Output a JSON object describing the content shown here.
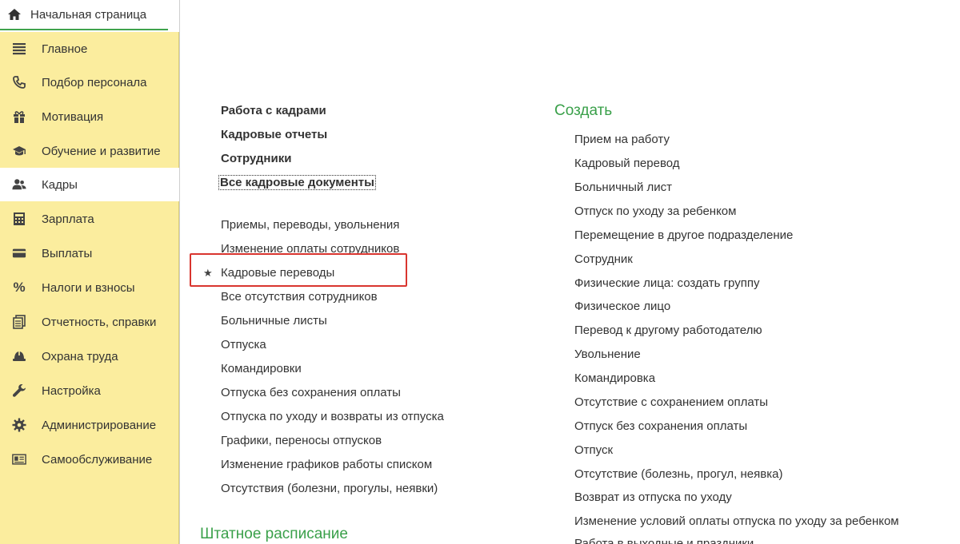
{
  "home": {
    "label": "Начальная страница"
  },
  "sidebar": {
    "items": [
      {
        "label": "Главное",
        "icon": "menu-icon"
      },
      {
        "label": "Подбор персонала",
        "icon": "phone-icon"
      },
      {
        "label": "Мотивация",
        "icon": "gift-icon"
      },
      {
        "label": "Обучение и развитие",
        "icon": "graduation-cap-icon"
      },
      {
        "label": "Кадры",
        "icon": "users-icon",
        "active": true
      },
      {
        "label": "Зарплата",
        "icon": "calculator-icon"
      },
      {
        "label": "Выплаты",
        "icon": "card-icon"
      },
      {
        "label": "Налоги и взносы",
        "icon": "percent-icon"
      },
      {
        "label": "Отчетность, справки",
        "icon": "documents-icon"
      },
      {
        "label": "Охрана труда",
        "icon": "helmet-icon"
      },
      {
        "label": "Настройка",
        "icon": "wrench-icon"
      },
      {
        "label": "Администрирование",
        "icon": "gear-icon"
      },
      {
        "label": "Самообслуживание",
        "icon": "id-card-icon"
      }
    ]
  },
  "main": {
    "bold_links": [
      "Работа с кадрами",
      "Кадровые отчеты",
      "Сотрудники",
      "Все кадровые документы"
    ],
    "links": [
      "Приемы, переводы, увольнения",
      "Изменение оплаты сотрудников",
      "Кадровые переводы",
      "Все отсутствия сотрудников",
      "Больничные листы",
      "Отпуска",
      "Командировки",
      "Отпуска без сохранения оплаты",
      "Отпуска по уходу и возвраты из отпуска",
      "Графики, переносы отпусков",
      "Изменение графиков работы списком",
      "Отсутствия (болезни, прогулы, неявки)"
    ],
    "staff_title": "Штатное расписание"
  },
  "create": {
    "title": "Создать",
    "items": [
      "Прием на работу",
      "Кадровый перевод",
      "Больничный лист",
      "Отпуск по уходу за ребенком",
      "Перемещение в другое подразделение",
      "Сотрудник",
      "Физические лица: создать группу",
      "Физическое лицо",
      "Перевод к другому работодателю",
      "Увольнение",
      "Командировка",
      "Отсутствие с сохранением оплаты",
      "Отпуск без сохранения оплаты",
      "Отпуск",
      "Отсутствие (болезнь, прогул, неявка)",
      "Возврат из отпуска по уходу",
      "Изменение условий оплаты отпуска по уходу за ребенком",
      "Работа в выходные и праздники"
    ]
  },
  "colors": {
    "sidebar_bg": "#fbed9e",
    "accent_green": "#3aa04a",
    "highlight_red": "#d9352f"
  }
}
